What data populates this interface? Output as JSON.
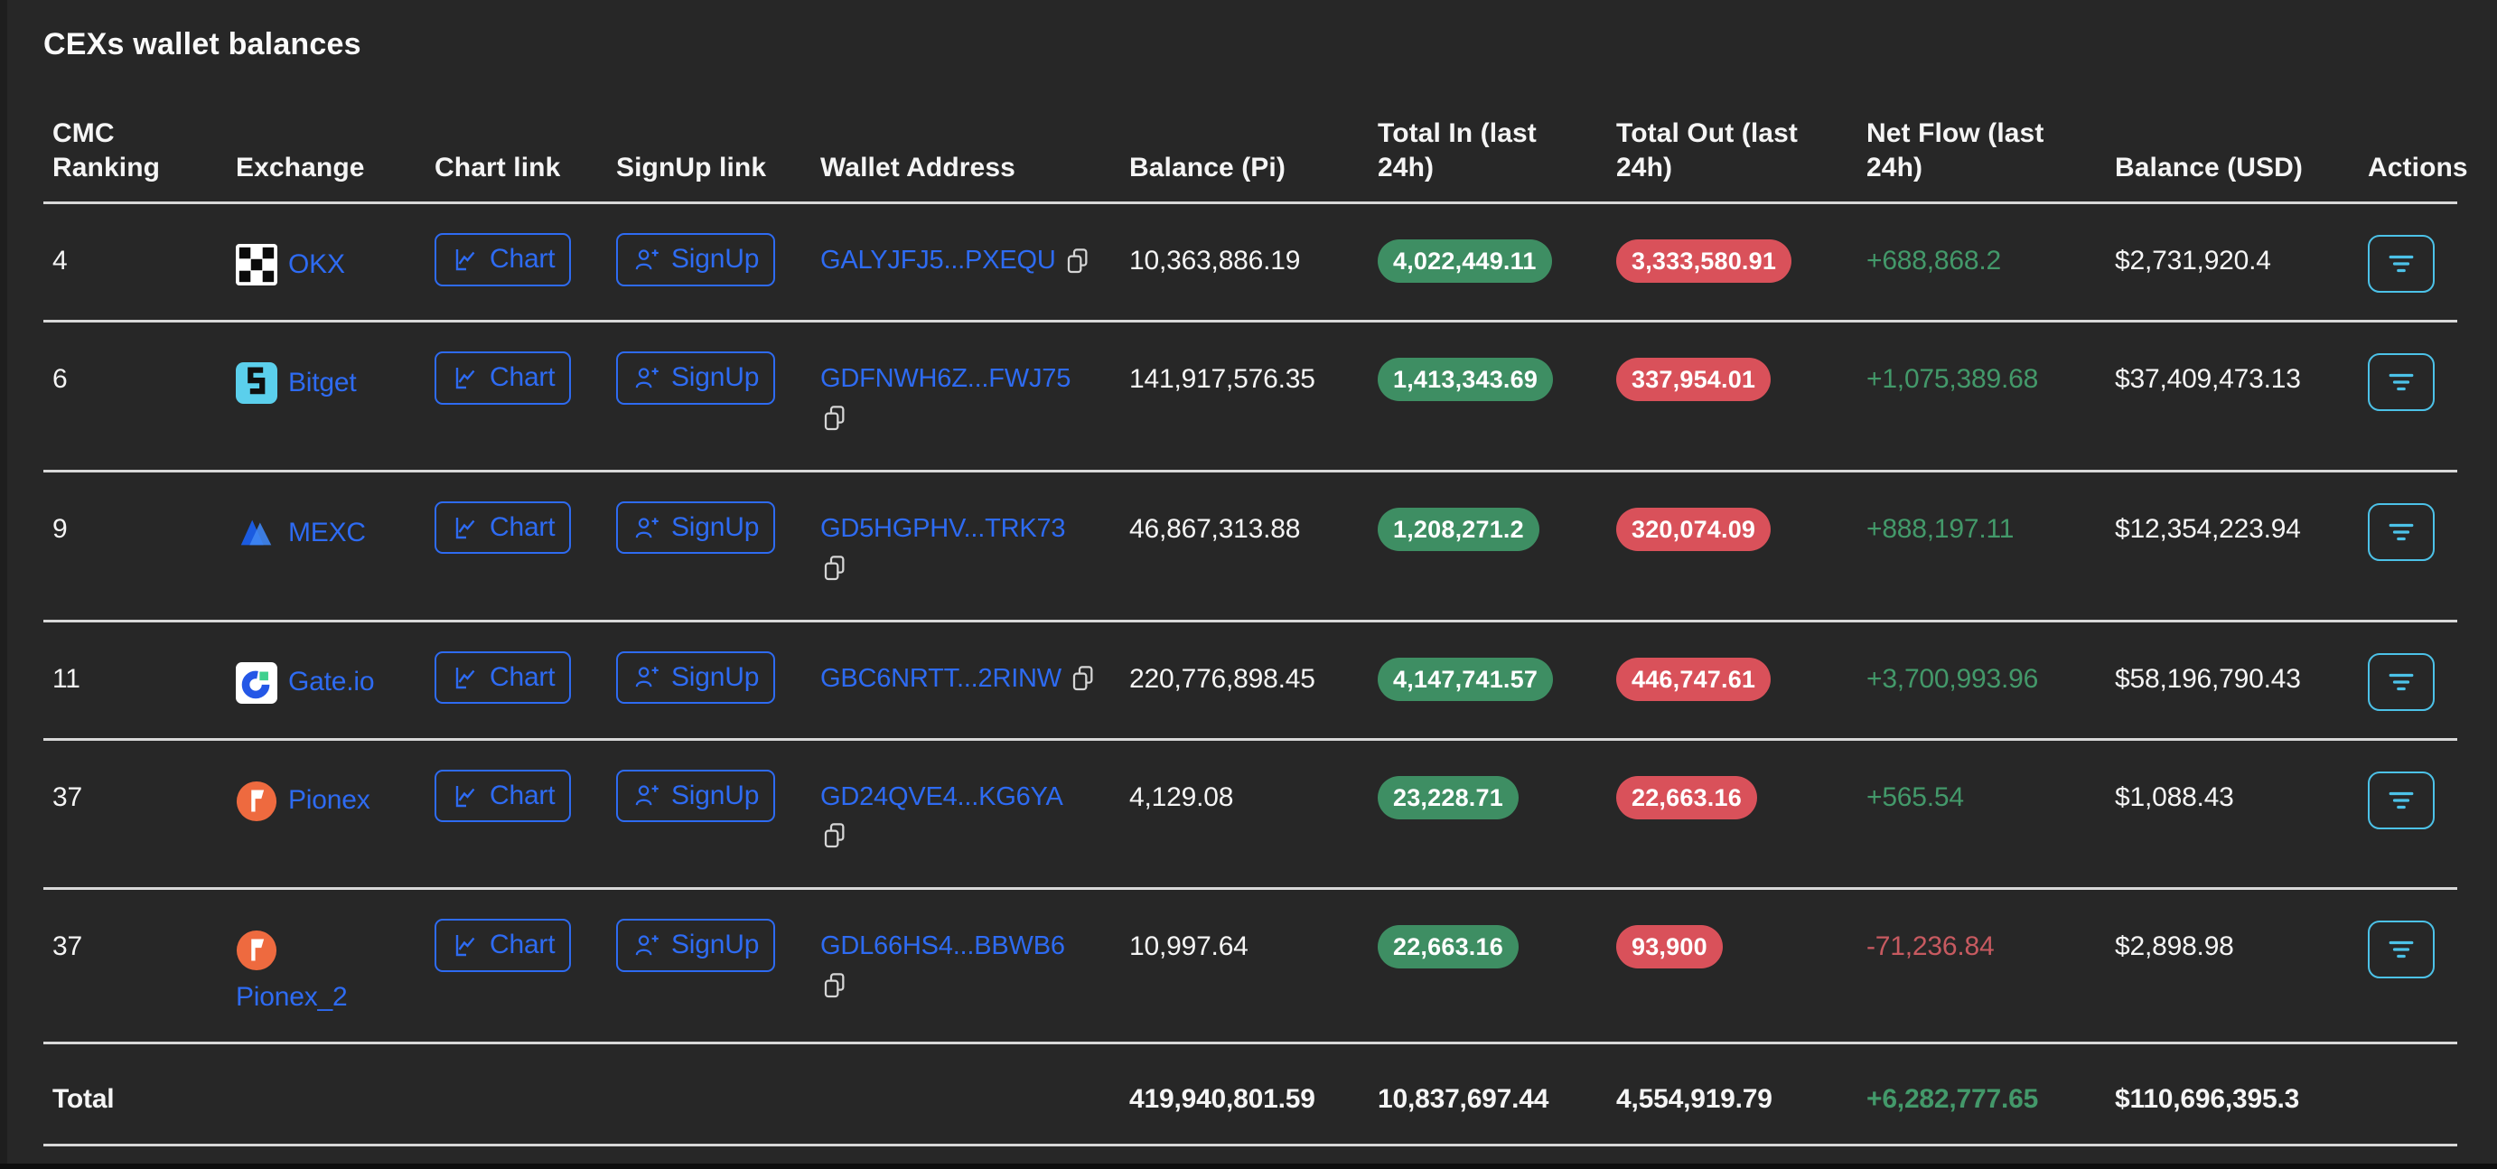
{
  "title": "CEXs wallet balances",
  "table": {
    "headers": [
      "CMC Ranking",
      "Exchange",
      "Chart link",
      "SignUp link",
      "Wallet Address",
      "Balance (Pi)",
      "Total In (last 24h)",
      "Total Out (last 24h)",
      "Net Flow (last 24h)",
      "Balance (USD)",
      "Actions"
    ],
    "chart_button_label": "Chart",
    "signup_button_label": "SignUp",
    "rows": [
      {
        "rank": "4",
        "name": "OKX",
        "logo": "okx",
        "address": "GALYJFJ5...PXEQU",
        "copy_inline": true,
        "name_wrapped": false,
        "balance_pi": "10,363,886.19",
        "total_in": "4,022,449.11",
        "total_out": "3,333,580.91",
        "net_flow": "+688,868.2",
        "balance_usd": "$2,731,920.4"
      },
      {
        "rank": "6",
        "name": "Bitget",
        "logo": "bitget",
        "address": "GDFNWH6Z...FWJ75",
        "copy_inline": false,
        "name_wrapped": false,
        "balance_pi": "141,917,576.35",
        "total_in": "1,413,343.69",
        "total_out": "337,954.01",
        "net_flow": "+1,075,389.68",
        "balance_usd": "$37,409,473.13"
      },
      {
        "rank": "9",
        "name": "MEXC",
        "logo": "mexc",
        "address": "GD5HGPHV...TRK73",
        "copy_inline": false,
        "name_wrapped": false,
        "balance_pi": "46,867,313.88",
        "total_in": "1,208,271.2",
        "total_out": "320,074.09",
        "net_flow": "+888,197.11",
        "balance_usd": "$12,354,223.94"
      },
      {
        "rank": "11",
        "name": "Gate.io",
        "logo": "gateio",
        "address": "GBC6NRTT...2RINW",
        "copy_inline": true,
        "name_wrapped": false,
        "balance_pi": "220,776,898.45",
        "total_in": "4,147,741.57",
        "total_out": "446,747.61",
        "net_flow": "+3,700,993.96",
        "balance_usd": "$58,196,790.43"
      },
      {
        "rank": "37",
        "name": "Pionex",
        "logo": "pionex",
        "address": "GD24QVE4...KG6YA",
        "copy_inline": false,
        "name_wrapped": false,
        "balance_pi": "4,129.08",
        "total_in": "23,228.71",
        "total_out": "22,663.16",
        "net_flow": "+565.54",
        "balance_usd": "$1,088.43"
      },
      {
        "rank": "37",
        "name": "Pionex_2",
        "logo": "pionex",
        "address": "GDL66HS4...BBWB6",
        "copy_inline": false,
        "name_wrapped": true,
        "balance_pi": "10,997.64",
        "total_in": "22,663.16",
        "total_out": "93,900",
        "net_flow": "-71,236.84",
        "balance_usd": "$2,898.98"
      }
    ],
    "total": {
      "label": "Total",
      "balance_pi": "419,940,801.59",
      "total_in": "10,837,697.44",
      "total_out": "4,554,919.79",
      "net_flow": "+6,282,777.65",
      "balance_usd": "$110,696,395.3"
    }
  },
  "icons": {
    "chart_button": "chart-line-icon",
    "signup_button": "person-add-icon",
    "wallet_copy": "copy-icon",
    "actions": "filter-icon"
  },
  "colors": {
    "background": "#272727",
    "link_blue": "#2e6bf2",
    "badge_green": "#3e8e63",
    "badge_red": "#d9515a",
    "positive_green": "#43996a",
    "negative_red": "#c75a60",
    "actions_cyan": "#4cc2e8",
    "separator": "#d8d8d8"
  }
}
